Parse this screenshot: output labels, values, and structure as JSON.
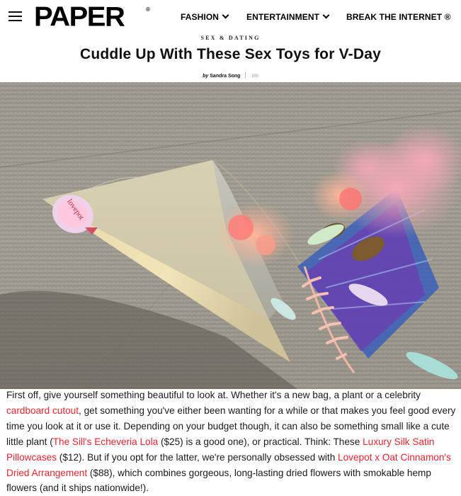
{
  "header": {
    "logo": "PAPER",
    "logo_mark": "®",
    "nav": [
      {
        "label": "FASHION"
      },
      {
        "label": "ENTERTAINMENT"
      },
      {
        "label": "BREAK THE INTERNET ®"
      }
    ]
  },
  "article": {
    "kicker": "SEX & DATING",
    "title": "Cuddle Up With These Sex Toys for V-Day",
    "byline_prefix": "by",
    "author": "Sandra Song",
    "time": "18h",
    "hero_sticker_text": "lovepot"
  },
  "body": {
    "t1": "First off, give yourself something beautiful to look at. Whether it's a new bag, a plant or a celebrity ",
    "link1": "cardboard cutout",
    "t2": ", get something you've either been wanting for a while or that makes you feel good every time you look at it or use it. Depending on your budget though, it can also be something small like a cute little plant (",
    "link2": "The Sill's Echeveria Lola",
    "t3": " ($25) is a good one), or practical. Think: These ",
    "link3": "Luxury Silk Satin Pillowcases",
    "t4": " ($12). But if you opt for the latter, we're personally obsessed with ",
    "link4": "Lovepot x Oat Cinnamon's Dried Arrangement",
    "t5": " ($88), which combines gorgeous, long-lasting dried flowers with smokable hemp flowers (and it ships nationwide!)."
  },
  "colors": {
    "link": "#e3262f",
    "text": "#1a1a1a"
  }
}
